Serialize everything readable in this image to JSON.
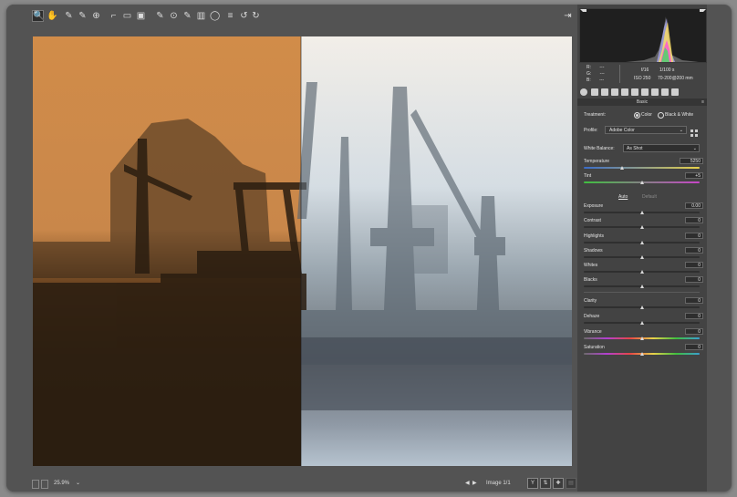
{
  "toolbar": {
    "tools": [
      {
        "name": "zoom-tool",
        "glyph": "🔍"
      },
      {
        "name": "hand-tool",
        "glyph": "✋"
      },
      {
        "name": "white-balance-tool",
        "glyph": "✎"
      },
      {
        "name": "color-sampler-tool",
        "glyph": "✎"
      },
      {
        "name": "targeted-adjustment-tool",
        "glyph": "⊕"
      },
      {
        "name": "crop-tool",
        "glyph": "⌐"
      },
      {
        "name": "straighten-tool",
        "glyph": "▭"
      },
      {
        "name": "transform-tool",
        "glyph": "▣"
      },
      {
        "name": "spot-removal-tool",
        "glyph": "✎"
      },
      {
        "name": "red-eye-tool",
        "glyph": "⊙"
      },
      {
        "name": "adjustment-brush-tool",
        "glyph": "✎"
      },
      {
        "name": "graduated-filter-tool",
        "glyph": "▥"
      },
      {
        "name": "radial-filter-tool",
        "glyph": "◯"
      },
      {
        "name": "preferences-icon",
        "glyph": "≡"
      },
      {
        "name": "rotate-left-icon",
        "glyph": "↺"
      },
      {
        "name": "rotate-right-icon",
        "glyph": "↻"
      }
    ],
    "export_glyph": "⇥"
  },
  "status": {
    "zoom": "25.9%",
    "image_counter": "Image 1/1",
    "y_label": "Y"
  },
  "camera": {
    "rgb": [
      {
        "k": "R:",
        "v": "---"
      },
      {
        "k": "G:",
        "v": "---"
      },
      {
        "k": "B:",
        "v": "---"
      }
    ],
    "aperture": "f/16",
    "shutter": "1/100 s",
    "iso": "ISO 250",
    "lens": "70-200@200 mm"
  },
  "panel": {
    "section_title": "Basic",
    "treatment_label": "Treatment:",
    "treatment_color": "Color",
    "treatment_bw": "Black & White",
    "profile_label": "Profile:",
    "profile_value": "Adobe Color",
    "wb_label": "White Balance:",
    "wb_value": "As Shot",
    "temperature_label": "Temperature",
    "temperature_value": "5250",
    "tint_label": "Tint",
    "tint_value": "+5",
    "auto_label": "Auto",
    "default_label": "Default",
    "sliders": [
      {
        "label": "Exposure",
        "value": "0.00"
      },
      {
        "label": "Contrast",
        "value": "0"
      },
      {
        "label": "Highlights",
        "value": "0"
      },
      {
        "label": "Shadows",
        "value": "0"
      },
      {
        "label": "Whites",
        "value": "0"
      },
      {
        "label": "Blacks",
        "value": "0"
      }
    ],
    "sliders2": [
      {
        "label": "Clarity",
        "value": "0"
      },
      {
        "label": "Dehaze",
        "value": "0"
      },
      {
        "label": "Vibrance",
        "value": "0"
      },
      {
        "label": "Saturation",
        "value": "0"
      }
    ]
  }
}
